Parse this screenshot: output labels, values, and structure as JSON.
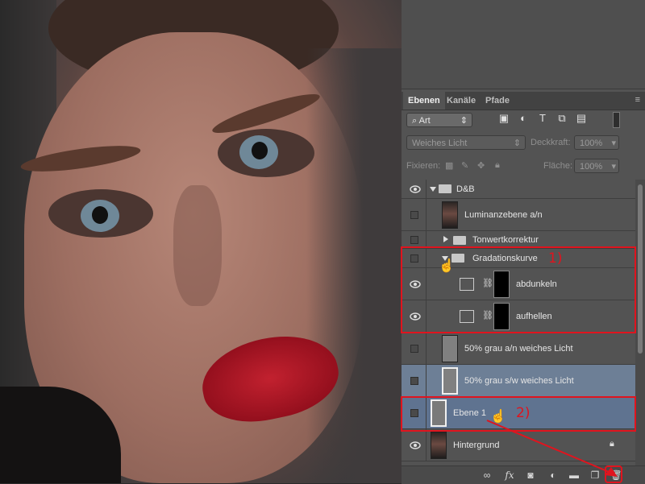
{
  "colors": {
    "annotation": "#e0141e",
    "selection": "#6d7f96",
    "panel_bg": "#535353"
  },
  "tabs": [
    {
      "label": "Ebenen",
      "active": true
    },
    {
      "label": "Kanäle",
      "active": false
    },
    {
      "label": "Pfade",
      "active": false
    }
  ],
  "filter": {
    "value": "Art",
    "icons": [
      "image-filter-icon",
      "adjustment-filter-icon",
      "type-filter-icon",
      "shape-filter-icon",
      "smart-object-filter-icon",
      "filter-toggle-icon"
    ]
  },
  "blend_mode": "Weiches Licht",
  "opacity": {
    "label": "Deckkraft:",
    "value": "100%"
  },
  "lock": {
    "label": "Fixieren:"
  },
  "fill": {
    "label": "Fläche:",
    "value": "100%"
  },
  "layers": {
    "group_db": "D&B",
    "luminanz": "Luminanzebene a/n",
    "tonwert": "Tonwertkorrektur",
    "gradation": "Gradationskurve",
    "abdunkeln": "abdunkeln",
    "aufhellen": "aufhellen",
    "grau_an": "50% grau a/n weiches Licht",
    "grau_sw": "50% grau s/w weiches Licht",
    "ebene1": "Ebene 1",
    "hintergrund": "Hintergrund"
  },
  "annotations": {
    "one": "1)",
    "two": "2)"
  },
  "bottom_icons": [
    "link-icon",
    "fx-icon",
    "mask-icon",
    "adjustment-icon",
    "new-group-icon",
    "new-layer-icon",
    "trash-icon"
  ],
  "bottom_labels": {
    "fx": "fx"
  }
}
